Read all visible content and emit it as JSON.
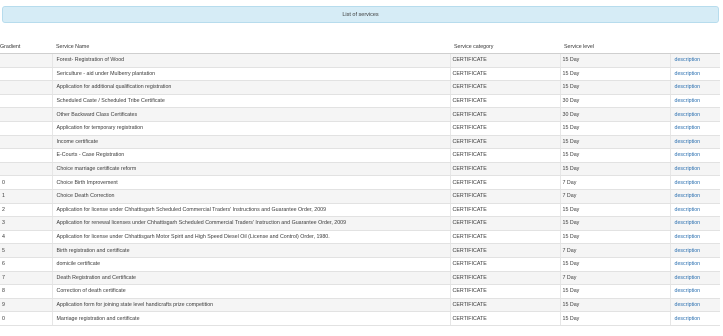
{
  "panel": {
    "title": "List of services"
  },
  "table": {
    "headers": {
      "gradient": "Gradient",
      "name": "Service Name",
      "category": "Service category",
      "level": "Service level",
      "action": ""
    },
    "rows": [
      {
        "idx": "",
        "name": "Forest- Registration of Wood",
        "category": "CERTIFICATE",
        "level": "15 Day",
        "action": "description"
      },
      {
        "idx": "",
        "name": "Sericulture - aid under Mulberry plantation",
        "category": "CERTIFICATE",
        "level": "15 Day",
        "action": "description"
      },
      {
        "idx": "",
        "name": "Application for additional qualification registration",
        "category": "CERTIFICATE",
        "level": "15 Day",
        "action": "description"
      },
      {
        "idx": "",
        "name": "Scheduled Caste / Scheduled Tribe Certificate",
        "category": "CERTIFICATE",
        "level": "30 Day",
        "action": "description"
      },
      {
        "idx": "",
        "name": "Other Backward Class Certificates",
        "category": "CERTIFICATE",
        "level": "30 Day",
        "action": "description"
      },
      {
        "idx": "",
        "name": "Application for temporary registration",
        "category": "CERTIFICATE",
        "level": "15 Day",
        "action": "description"
      },
      {
        "idx": "",
        "name": "Income certificate",
        "category": "CERTIFICATE",
        "level": "15 Day",
        "action": "description"
      },
      {
        "idx": "",
        "name": "E-Courts - Case Registration",
        "category": "CERTIFICATE",
        "level": "15 Day",
        "action": "description"
      },
      {
        "idx": "",
        "name": "Choice marriage certificate reform",
        "category": "CERTIFICATE",
        "level": "15 Day",
        "action": "description"
      },
      {
        "idx": "0",
        "name": "Choice Birth Improvement",
        "category": "CERTIFICATE",
        "level": "7 Day",
        "action": "description"
      },
      {
        "idx": "1",
        "name": "Choice Death Correction",
        "category": "CERTIFICATE",
        "level": "7 Day",
        "action": "description"
      },
      {
        "idx": "2",
        "name": "Application for license under Chhattisgarh Scheduled Commercial Traders' Instructions and Guarantee Order, 2009",
        "category": "CERTIFICATE",
        "level": "15 Day",
        "action": "description"
      },
      {
        "idx": "3",
        "name": "Application for renewal licenses under Chhattisgarh Scheduled Commercial Traders' Instruction and Guarantee Order, 2009",
        "category": "CERTIFICATE",
        "level": "15 Day",
        "action": "description"
      },
      {
        "idx": "4",
        "name": "Application for license under Chhattisgarh Motor Spirit and High Speed Diesel Oil (License and Control) Order, 1980.",
        "category": "CERTIFICATE",
        "level": "15 Day",
        "action": "description"
      },
      {
        "idx": "5",
        "name": "Birth registration and certificate",
        "category": "CERTIFICATE",
        "level": "7 Day",
        "action": "description"
      },
      {
        "idx": "6",
        "name": "domicile certificate",
        "category": "CERTIFICATE",
        "level": "15 Day",
        "action": "description"
      },
      {
        "idx": "7",
        "name": "Death Registration and Certificate",
        "category": "CERTIFICATE",
        "level": "7 Day",
        "action": "description"
      },
      {
        "idx": "8",
        "name": "Correction of death certificate",
        "category": "CERTIFICATE",
        "level": "15 Day",
        "action": "description"
      },
      {
        "idx": "9",
        "name": "Application form for joining state level handicrafts prize competition",
        "category": "CERTIFICATE",
        "level": "15 Day",
        "action": "description"
      },
      {
        "idx": "0",
        "name": "Marriage registration and certificate",
        "category": "CERTIFICATE",
        "level": "15 Day",
        "action": "description"
      }
    ]
  }
}
